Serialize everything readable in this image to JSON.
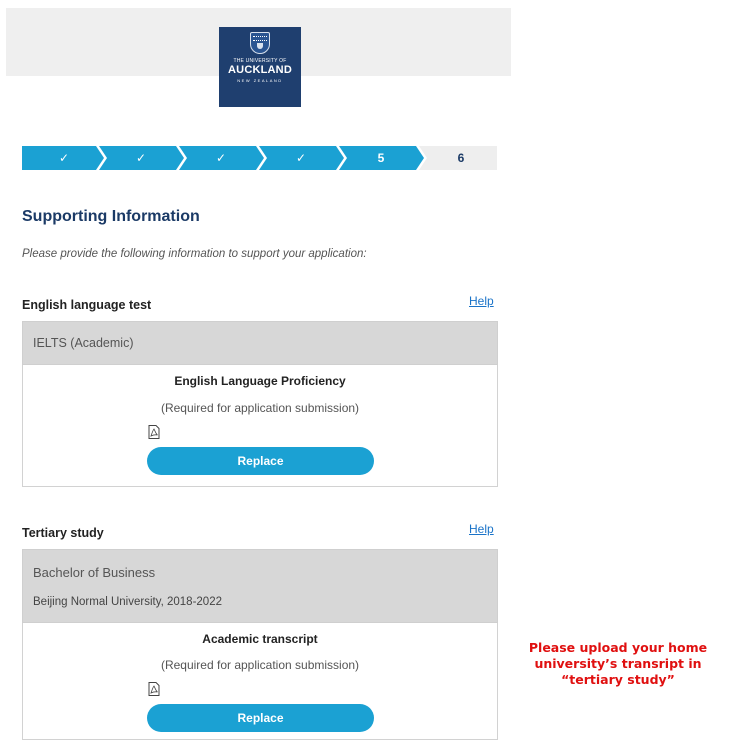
{
  "header": {
    "logo": {
      "line1": "THE UNIVERSITY OF",
      "line2": "AUCKLAND",
      "line3": "NEW ZEALAND",
      "icon": "crest-icon"
    }
  },
  "stepper": {
    "steps": [
      {
        "label": "✓",
        "state": "complete"
      },
      {
        "label": "✓",
        "state": "complete"
      },
      {
        "label": "✓",
        "state": "complete"
      },
      {
        "label": "✓",
        "state": "complete"
      },
      {
        "label": "5",
        "state": "current"
      },
      {
        "label": "6",
        "state": "upcoming"
      }
    ],
    "active_color": "#1ba1d3",
    "inactive_color": "#eeeeee"
  },
  "page": {
    "title": "Supporting Information",
    "intro": "Please provide the following information to support your application:"
  },
  "english_test": {
    "heading": "English language test",
    "help_label": "Help",
    "test_name": "IELTS (Academic)",
    "document_title": "English Language Proficiency",
    "note": "(Required for application submission)",
    "file_icon": "pdf-icon",
    "replace_label": "Replace"
  },
  "tertiary": {
    "heading": "Tertiary study",
    "help_label": "Help",
    "degree": "Bachelor of Business",
    "institution": "Beijing Normal University, 2018-2022",
    "document_title": "Academic transcript",
    "note": "(Required for application submission)",
    "file_icon": "pdf-icon",
    "replace_label": "Replace"
  },
  "annotation": {
    "text": "Please upload your home university’s transript in “tertiary study”",
    "color": "#e01010"
  }
}
